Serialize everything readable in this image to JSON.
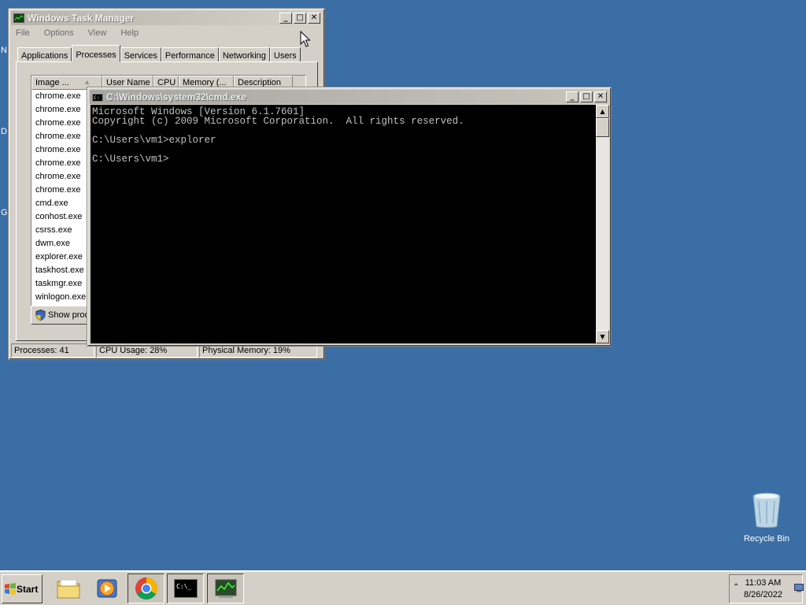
{
  "desktop": {
    "left_fragments": [
      "N",
      "D",
      "G"
    ],
    "recycle_bin_label": "Recycle Bin"
  },
  "task_manager": {
    "title": "Windows Task Manager",
    "menu": [
      "File",
      "Options",
      "View",
      "Help"
    ],
    "tabs": [
      "Applications",
      "Processes",
      "Services",
      "Performance",
      "Networking",
      "Users"
    ],
    "active_tab": "Processes",
    "columns": [
      "Image ...",
      "User Name",
      "CPU",
      "Memory (...",
      "Description"
    ],
    "processes": [
      "chrome.exe",
      "chrome.exe",
      "chrome.exe",
      "chrome.exe",
      "chrome.exe",
      "chrome.exe",
      "chrome.exe",
      "chrome.exe",
      "cmd.exe",
      "conhost.exe",
      "csrss.exe",
      "dwm.exe",
      "explorer.exe",
      "taskhost.exe",
      "taskmgr.exe",
      "winlogon.exe"
    ],
    "show_processes_button": "Show processes from all users",
    "status": {
      "processes": "Processes: 41",
      "cpu": "CPU Usage: 28%",
      "memory": "Physical Memory: 19%"
    }
  },
  "cmd": {
    "title": "C:\\Windows\\system32\\cmd.exe",
    "lines": [
      "Microsoft Windows [Version 6.1.7601]",
      "Copyright (c) 2009 Microsoft Corporation.  All rights reserved.",
      "",
      "C:\\Users\\vm1>explorer",
      "",
      "C:\\Users\\vm1>"
    ]
  },
  "taskbar": {
    "start_label": "Start",
    "pinned": [
      "explorer-folder-icon",
      "media-player-icon",
      "chrome-icon",
      "cmd-icon",
      "task-manager-icon"
    ],
    "clock": {
      "time": "11:03 AM",
      "date": "8/26/2022"
    }
  }
}
